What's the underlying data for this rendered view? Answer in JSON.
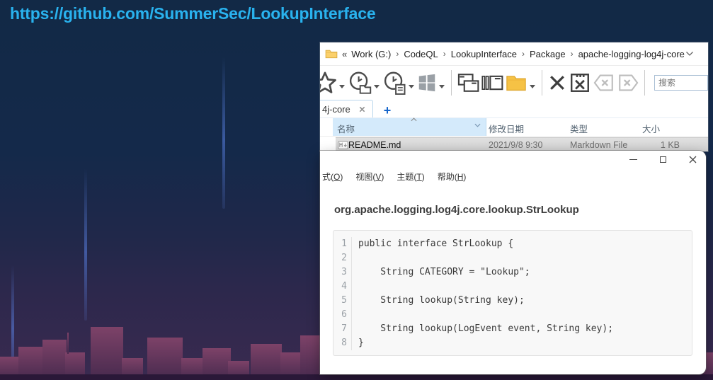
{
  "slide": {
    "url_text": "https://github.com/SummerSec/LookupInterface",
    "accent_color": "#29b2ee",
    "background_color": "#122946",
    "skyline_color": "#6d3a60"
  },
  "explorer": {
    "breadcrumb": {
      "overflow_chevrons": "«",
      "separator": "›",
      "items": [
        "Work (G:)",
        "CodeQL",
        "LookupInterface",
        "Package",
        "apache-logging-log4j-core"
      ],
      "icons": [
        "folder-icon",
        "chevron-down-icon"
      ]
    },
    "toolbar": {
      "icons": [
        "star-icon",
        "clock-folder-icon",
        "clock-document-icon",
        "windows-logo-icon",
        "cascade-windows-icon",
        "tile-windows-icon",
        "folder-icon",
        "close-x-icon",
        "close-window-icon",
        "close-tab-left-disabled-icon",
        "close-tab-right-disabled-icon",
        "search-input"
      ],
      "search_placeholder": "搜索"
    },
    "tabs": {
      "active_tab_label": "4j-core",
      "close_icon": "tab-close-icon",
      "new_tab_label": "+"
    },
    "list": {
      "columns": [
        "名称",
        "修改日期",
        "类型",
        "大小"
      ],
      "rows": [
        {
          "icon": "markdown-file-icon",
          "name": "README.md",
          "modified": "2021/9/8 9:30",
          "type": "Markdown File",
          "size": "1 KB"
        }
      ]
    }
  },
  "editor": {
    "window_controls": [
      "minimize-icon",
      "maximize-icon",
      "close-icon"
    ],
    "menu": [
      {
        "pre": "式(",
        "key": "O",
        "post": ")"
      },
      {
        "pre": "视图(",
        "key": "V",
        "post": ")"
      },
      {
        "pre": "主题(",
        "key": "T",
        "post": ")"
      },
      {
        "pre": "帮助(",
        "key": "H",
        "post": ")"
      }
    ],
    "title": "org.apache.logging.log4j.core.lookup.StrLookup",
    "code": {
      "lines": [
        {
          "num": "1",
          "text": "public interface StrLookup {"
        },
        {
          "num": "2",
          "text": ""
        },
        {
          "num": "3",
          "text": "    String CATEGORY = \"Lookup\";"
        },
        {
          "num": "4",
          "text": ""
        },
        {
          "num": "5",
          "text": "    String lookup(String key);"
        },
        {
          "num": "6",
          "text": ""
        },
        {
          "num": "7",
          "text": "    String lookup(LogEvent event, String key);"
        },
        {
          "num": "8",
          "text": "}"
        }
      ]
    }
  }
}
